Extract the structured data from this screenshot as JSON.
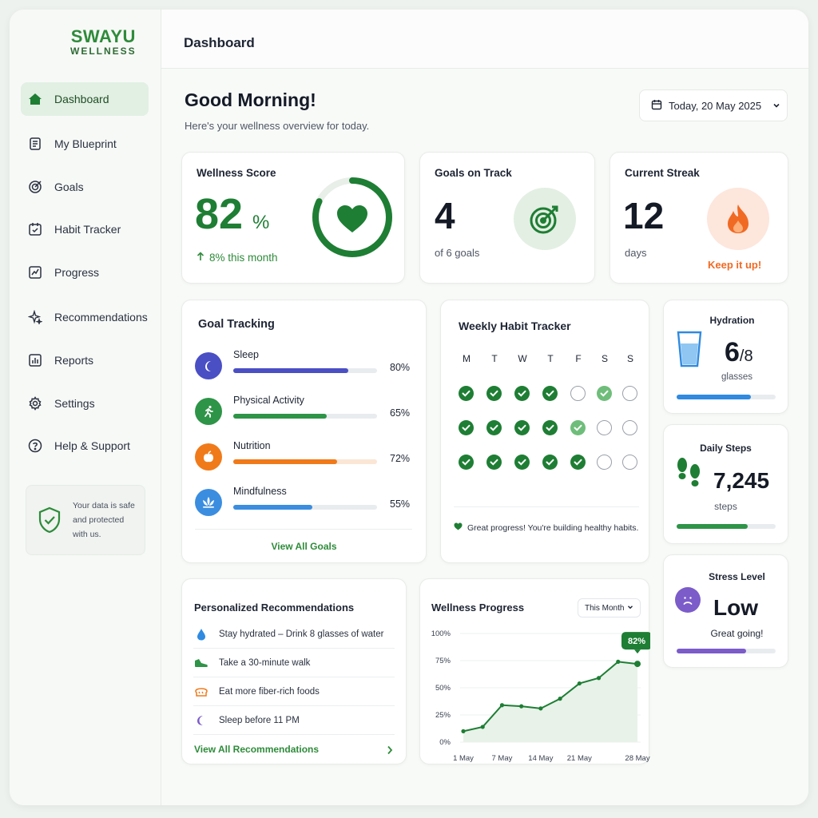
{
  "brand": {
    "line1": "SWAYU",
    "line2": "WELLNESS"
  },
  "topbar": {
    "title": "Dashboard"
  },
  "sidebar": {
    "items": [
      {
        "label": "Dashboard",
        "icon": "home-icon"
      },
      {
        "label": "My Blueprint",
        "icon": "blueprint-icon"
      },
      {
        "label": "Goals",
        "icon": "target-icon"
      },
      {
        "label": "Habit Tracker",
        "icon": "calendar-check-icon"
      },
      {
        "label": "Progress",
        "icon": "chart-icon"
      },
      {
        "label": "Recommendations",
        "icon": "sparkles-icon"
      },
      {
        "label": "Reports",
        "icon": "bar-chart-icon"
      },
      {
        "label": "Settings",
        "icon": "gear-icon"
      },
      {
        "label": "Help & Support",
        "icon": "help-icon"
      }
    ],
    "safe_text": "Your data is safe and protected with us."
  },
  "greeting": {
    "title": "Good Morning!",
    "subtitle": "Here's your wellness overview for today."
  },
  "date_picker": {
    "label": "Today, 20 May 2025"
  },
  "wellness_score": {
    "title": "Wellness Score",
    "value": "82",
    "unit": "%",
    "change": "8% this month",
    "fraction": 0.82
  },
  "goals_on_track": {
    "title": "Goals on Track",
    "value": "4",
    "sub": "of 6 goals"
  },
  "streak": {
    "title": "Current Streak",
    "value": "12",
    "sub": "days",
    "note": "Keep it up!"
  },
  "goal_tracking": {
    "title": "Goal Tracking",
    "goals": [
      {
        "label": "Sleep",
        "pct": "80%",
        "value": 0.8,
        "color": "#4a4fc4",
        "icon": "moon-icon"
      },
      {
        "label": "Physical Activity",
        "pct": "65%",
        "value": 0.65,
        "color": "#2e9447",
        "icon": "runner-icon"
      },
      {
        "label": "Nutrition",
        "pct": "72%",
        "value": 0.72,
        "color": "#f07a1a",
        "icon": "apple-icon"
      },
      {
        "label": "Mindfulness",
        "pct": "55%",
        "value": 0.55,
        "color": "#3b8de0",
        "icon": "lotus-icon"
      }
    ],
    "link": "View All Goals"
  },
  "habit_tracker": {
    "title": "Weekly Habit Tracker",
    "days": [
      "M",
      "T",
      "W",
      "T",
      "F",
      "S",
      "S"
    ],
    "rows": [
      [
        "full",
        "full",
        "full",
        "full",
        "empty",
        "light",
        "empty"
      ],
      [
        "full",
        "full",
        "full",
        "full",
        "light",
        "empty",
        "empty"
      ],
      [
        "full",
        "full",
        "full",
        "full",
        "full",
        "empty",
        "empty"
      ]
    ],
    "note": "Great progress! You're building healthy habits."
  },
  "hydration": {
    "title": "Hydration",
    "value": "6",
    "total": "/8",
    "unit": "glasses",
    "fraction": 0.75
  },
  "steps": {
    "title": "Daily Steps",
    "value": "7,245",
    "unit": "steps",
    "fraction": 0.72
  },
  "stress": {
    "title": "Stress Level",
    "value": "Low",
    "note": "Great going!",
    "fraction": 0.7
  },
  "recommendations": {
    "title": "Personalized Recommendations",
    "items": [
      {
        "label": "Stay hydrated – Drink 8 glasses of water",
        "icon": "water-drop-icon"
      },
      {
        "label": "Take a 30-minute walk",
        "icon": "shoe-icon"
      },
      {
        "label": "Eat more fiber-rich foods",
        "icon": "bread-icon"
      },
      {
        "label": "Sleep before 11 PM",
        "icon": "moon-icon"
      }
    ],
    "link": "View All Recommendations"
  },
  "wellness_progress": {
    "title": "Wellness Progress",
    "range_select": "This Month",
    "badge": "82%"
  },
  "chart_data": {
    "type": "area",
    "title": "Wellness Progress",
    "x": [
      "1 May",
      "3 May",
      "7 May",
      "11 May",
      "14 May",
      "17 May",
      "21 May",
      "23 May",
      "26 May",
      "28 May"
    ],
    "values": [
      10,
      14,
      34,
      33,
      31,
      40,
      54,
      59,
      74,
      72
    ],
    "xticks": [
      "1 May",
      "7 May",
      "14 May",
      "21 May",
      "28 May"
    ],
    "yticks": [
      "0%",
      "25%",
      "50%",
      "75%",
      "100%"
    ],
    "ylim": [
      0,
      100
    ],
    "color": "#1e7e34"
  },
  "colors": {
    "brand": "#2e8b3a",
    "accent_dark": "#1e7e34",
    "streak_orange": "#f06a24",
    "stress_purple": "#7b5cc9"
  }
}
